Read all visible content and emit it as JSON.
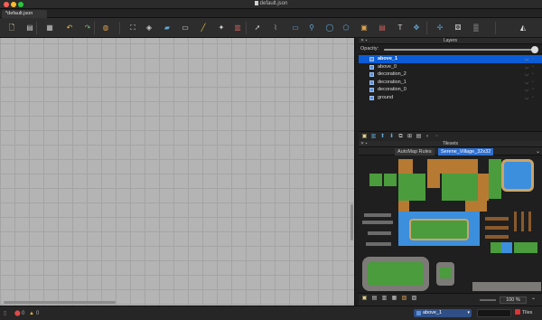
{
  "window": {
    "title": "default.json"
  },
  "tabs": [
    {
      "label": "*default.json"
    }
  ],
  "toolbar": {
    "buttons": [
      {
        "name": "new-map-icon",
        "glyph": "🗋",
        "color": "#e8e0b0"
      },
      {
        "name": "save-icon",
        "glyph": "▤",
        "color": "#c8c8c8"
      },
      {
        "name": "export-icon",
        "glyph": "▦",
        "color": "#c8c8c8"
      },
      {
        "name": "undo-icon",
        "glyph": "↶",
        "color": "#e6b84a"
      },
      {
        "name": "redo-icon",
        "glyph": "↷",
        "color": "#6fb86f"
      },
      {
        "name": "stamp-brush-icon",
        "glyph": "◍",
        "color": "#d89a4a"
      },
      {
        "name": "terrain-brush-icon",
        "glyph": "⛶",
        "color": "#d0d0d0"
      },
      {
        "name": "bucket-fill-icon",
        "glyph": "◈",
        "color": "#d0d0d0"
      },
      {
        "name": "shape-fill-icon",
        "glyph": "▰",
        "color": "#5fa8d8"
      },
      {
        "name": "eraser-icon",
        "glyph": "▭",
        "color": "#e0e0e0"
      },
      {
        "name": "rect-select-icon",
        "glyph": "╱",
        "color": "#e0c040"
      },
      {
        "name": "magic-wand-icon",
        "glyph": "✦",
        "color": "#d0d0d0"
      },
      {
        "name": "select-same-tile-icon",
        "glyph": "▥",
        "color": "#c86060"
      },
      {
        "name": "object-select-icon",
        "glyph": "➚",
        "color": "#d0d0d0"
      },
      {
        "name": "edit-polygons-icon",
        "glyph": "⌇",
        "color": "#a0a0a0"
      },
      {
        "name": "insert-rectangle-icon",
        "glyph": "▭",
        "color": "#5fa8d8"
      },
      {
        "name": "insert-point-icon",
        "glyph": "⚲",
        "color": "#5fa8d8"
      },
      {
        "name": "insert-ellipse-icon",
        "glyph": "◯",
        "color": "#5fa8d8"
      },
      {
        "name": "insert-polygon-icon",
        "glyph": "⬠",
        "color": "#5fa8d8"
      },
      {
        "name": "insert-tile-icon",
        "glyph": "▣",
        "color": "#d8a050"
      },
      {
        "name": "insert-template-icon",
        "glyph": "▤",
        "color": "#c86060"
      },
      {
        "name": "insert-text-icon",
        "glyph": "T",
        "color": "#d0d0d0"
      },
      {
        "name": "world-tool-icon",
        "glyph": "✥",
        "color": "#5fa8d8"
      },
      {
        "name": "move-icon",
        "glyph": "✢",
        "color": "#5fa8d8"
      },
      {
        "name": "random-mode-icon",
        "glyph": "⚄",
        "color": "#e0e0e0"
      },
      {
        "name": "wang-fill-icon",
        "glyph": "▒",
        "color": "#c0c0c0"
      },
      {
        "name": "flip-icon",
        "glyph": "◭",
        "color": "#e0e0e0"
      }
    ]
  },
  "layers_panel": {
    "title": "Layers",
    "opacity_label": "Opacity:",
    "opacity": 1.0,
    "layers": [
      {
        "name": "above_1",
        "selected": true
      },
      {
        "name": "above_0",
        "selected": false
      },
      {
        "name": "decoration_2",
        "selected": false
      },
      {
        "name": "decoration_1",
        "selected": false
      },
      {
        "name": "decoration_0",
        "selected": false
      },
      {
        "name": "ground",
        "selected": false
      }
    ]
  },
  "tilesets_panel": {
    "title": "Tilesets",
    "tabs": [
      {
        "label": "AutoMap Rules"
      },
      {
        "label": "Serene_Village_32x32"
      }
    ],
    "zoom": "100 %"
  },
  "statusbar": {
    "errors": "0",
    "warnings": "0",
    "current_layer": "above_1",
    "tiles_label": "Tiles"
  },
  "colors": {
    "selection": "#0b5cd6",
    "grass": "#4a9c3c",
    "dirt": "#b77a32",
    "water": "#3c8fdc"
  }
}
